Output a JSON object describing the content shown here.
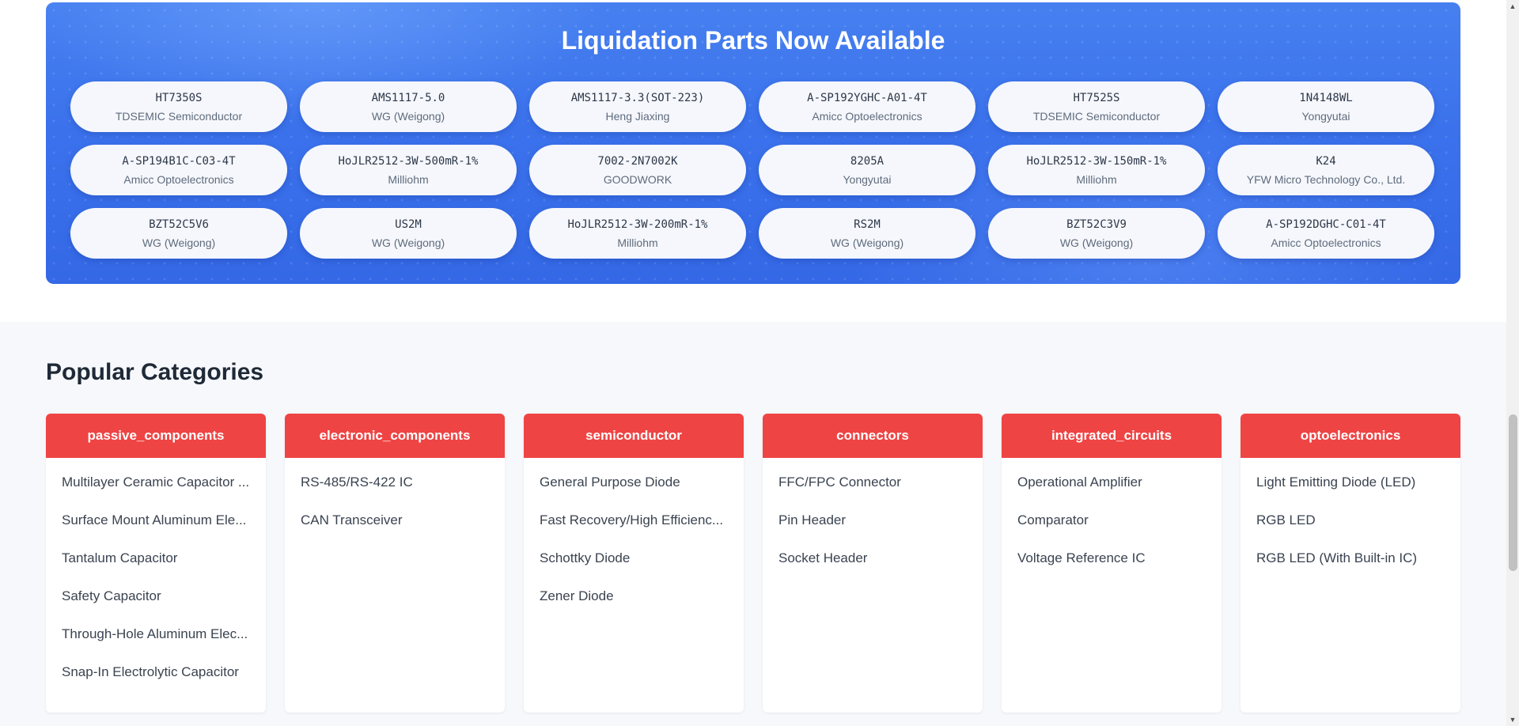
{
  "liquidation": {
    "title": "Liquidation Parts Now Available",
    "parts": [
      {
        "part": "HT7350S",
        "maker": "TDSEMIC Semiconductor"
      },
      {
        "part": "AMS1117-5.0",
        "maker": "WG (Weigong)"
      },
      {
        "part": "AMS1117-3.3(SOT-223)",
        "maker": "Heng Jiaxing"
      },
      {
        "part": "A-SP192YGHC-A01-4T",
        "maker": "Amicc Optoelectronics"
      },
      {
        "part": "HT7525S",
        "maker": "TDSEMIC Semiconductor"
      },
      {
        "part": "1N4148WL",
        "maker": "Yongyutai"
      },
      {
        "part": "A-SP194B1C-C03-4T",
        "maker": "Amicc Optoelectronics"
      },
      {
        "part": "HoJLR2512-3W-500mR-1%",
        "maker": "Milliohm"
      },
      {
        "part": "7002-2N7002K",
        "maker": "GOODWORK"
      },
      {
        "part": "8205A",
        "maker": "Yongyutai"
      },
      {
        "part": "HoJLR2512-3W-150mR-1%",
        "maker": "Milliohm"
      },
      {
        "part": "K24",
        "maker": "YFW Micro Technology Co., Ltd."
      },
      {
        "part": "BZT52C5V6",
        "maker": "WG (Weigong)"
      },
      {
        "part": "US2M",
        "maker": "WG (Weigong)"
      },
      {
        "part": "HoJLR2512-3W-200mR-1%",
        "maker": "Milliohm"
      },
      {
        "part": "RS2M",
        "maker": "WG (Weigong)"
      },
      {
        "part": "BZT52C3V9",
        "maker": "WG (Weigong)"
      },
      {
        "part": "A-SP192DGHC-C01-4T",
        "maker": "Amicc Optoelectronics"
      }
    ]
  },
  "categories": {
    "title": "Popular Categories",
    "cards": [
      {
        "name": "passive_components",
        "items": [
          "Multilayer Ceramic Capacitor ...",
          "Surface Mount Aluminum Ele...",
          "Tantalum Capacitor",
          "Safety Capacitor",
          "Through-Hole Aluminum Elec...",
          "Snap-In Electrolytic Capacitor"
        ]
      },
      {
        "name": "electronic_components",
        "items": [
          "RS-485/RS-422 IC",
          "CAN Transceiver"
        ]
      },
      {
        "name": "semiconductor",
        "items": [
          "General Purpose Diode",
          "Fast Recovery/High Efficienc...",
          "Schottky Diode",
          "Zener Diode"
        ]
      },
      {
        "name": "connectors",
        "items": [
          "FFC/FPC Connector",
          "Pin Header",
          "Socket Header"
        ]
      },
      {
        "name": "integrated_circuits",
        "items": [
          "Operational Amplifier",
          "Comparator",
          "Voltage Reference IC"
        ]
      },
      {
        "name": "optoelectronics",
        "items": [
          "Light Emitting Diode (LED)",
          "RGB LED",
          "RGB LED (With Built-in IC)"
        ]
      }
    ]
  },
  "scrollbar": {
    "up_icon": "triangle-up-icon",
    "down_icon": "triangle-down-icon"
  }
}
